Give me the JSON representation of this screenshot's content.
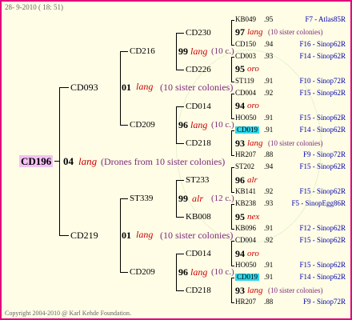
{
  "header": {
    "date": "28-  9-2010 ( 18: 51)"
  },
  "footer": {
    "copyright": "Copyright 2004-2010 @ Karl Kehde Foundation."
  },
  "root": {
    "code": "CD196",
    "gen": "04",
    "race": "lang",
    "note": "(Drones from 10 sister colonies)"
  },
  "l1_top": "CD093",
  "l1_bottom": "CD219",
  "l1_top_node": {
    "gen": "01",
    "race": "lang",
    "note": "(10 sister colonies)"
  },
  "l1_bottom_node": {
    "gen": "01",
    "race": "lang",
    "note": "(10 sister colonies)"
  },
  "l2": [
    {
      "code": "CD216"
    },
    {
      "code": "CD209"
    },
    {
      "code": "ST339"
    },
    {
      "code": "CD209"
    }
  ],
  "l2_nodes": [
    {
      "gen": "99",
      "race": "lang",
      "note": "(10 c.)"
    },
    {
      "gen": "96",
      "race": "lang",
      "note": "(10 c.)"
    },
    {
      "gen": "99",
      "race": "alr",
      "note": "(12 c.)"
    },
    {
      "gen": "96",
      "race": "lang",
      "note": "(10 c.)"
    }
  ],
  "l3": [
    "CD230",
    "CD226",
    "CD014",
    "CD218",
    "ST233",
    "KB008",
    "CD014",
    "CD218"
  ],
  "l4": [
    {
      "type": "row",
      "code": "KB049",
      "val": ".95",
      "ped": "F7 - Atlas85R"
    },
    {
      "type": "node",
      "gen": "97",
      "race": "lang",
      "note": "(10 sister colonies)"
    },
    {
      "type": "row",
      "code": "CD150",
      "val": ".94",
      "ped": "F16 - Sinop62R"
    },
    {
      "type": "row",
      "code": "CD003",
      "val": ".93",
      "ped": "F14 - Sinop62R"
    },
    {
      "type": "node",
      "gen": "95",
      "race": "oro",
      "note": ""
    },
    {
      "type": "row",
      "code": "ST119",
      "val": ".91",
      "ped": "F10 - Sinop72R"
    },
    {
      "type": "row",
      "code": "CD004",
      "val": ".92",
      "ped": "F15 - Sinop62R"
    },
    {
      "type": "node",
      "gen": "94",
      "race": "oro",
      "note": ""
    },
    {
      "type": "row",
      "code": "HO050",
      "val": ".91",
      "ped": "F15 - Sinop62R"
    },
    {
      "type": "rowhl",
      "code": "CD019",
      "val": ".91",
      "ped": "F14 - Sinop62R"
    },
    {
      "type": "node",
      "gen": "93",
      "race": "lang",
      "note": "(10 sister colonies)"
    },
    {
      "type": "row",
      "code": "HR207",
      "val": ".88",
      "ped": "F9 - Sinop72R"
    },
    {
      "type": "row",
      "code": "ST202",
      "val": ".94",
      "ped": "F15 - Sinop62R"
    },
    {
      "type": "node",
      "gen": "96",
      "race": "alr",
      "note": ""
    },
    {
      "type": "row",
      "code": "KB141",
      "val": ".92",
      "ped": "F15 - Sinop62R"
    },
    {
      "type": "row",
      "code": "KB238",
      "val": ".93",
      "ped": "F5 - SinopEgg86R"
    },
    {
      "type": "node",
      "gen": "95",
      "race": "nex",
      "note": ""
    },
    {
      "type": "row",
      "code": "KB096",
      "val": ".91",
      "ped": "F12 - Sinop62R"
    },
    {
      "type": "row",
      "code": "CD004",
      "val": ".92",
      "ped": "F15 - Sinop62R"
    },
    {
      "type": "node",
      "gen": "94",
      "race": "oro",
      "note": ""
    },
    {
      "type": "row",
      "code": "HO050",
      "val": ".91",
      "ped": "F15 - Sinop62R"
    },
    {
      "type": "rowhl",
      "code": "CD019",
      "val": ".91",
      "ped": "F14 - Sinop62R"
    },
    {
      "type": "node",
      "gen": "93",
      "race": "lang",
      "note": "(10 sister colonies)"
    },
    {
      "type": "row",
      "code": "HR207",
      "val": ".88",
      "ped": "F9 - Sinop72R"
    }
  ]
}
